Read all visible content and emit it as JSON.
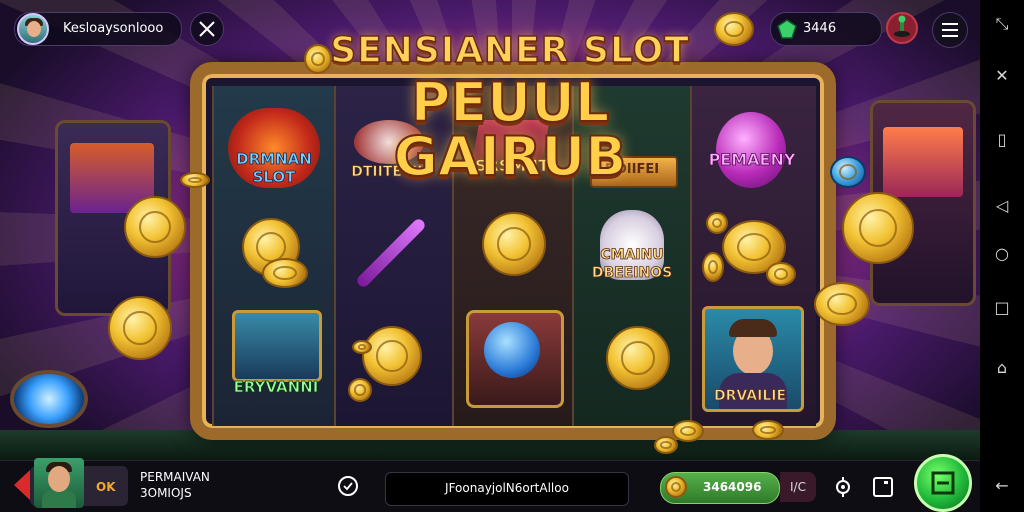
{
  "header": {
    "username": "Kesloaysonlooo",
    "balance": "3446"
  },
  "title": {
    "line1": "SENSIANER SLOT",
    "line2": "PEUUL GAIRUB"
  },
  "reels": {
    "r1_top": "DRMNAN SLOT",
    "r2_top": "DTIITE IIIC",
    "r3_top": "SRSMIIT",
    "r4_top": "DOIIFEI",
    "r5_top": "PEMAENY",
    "r4_mid": "CMAINU DBEEINOS",
    "r1_bottom": "ERYVANNI",
    "r5_bottom": "DRVAILIE"
  },
  "bottom": {
    "ok_tag": "OK",
    "player_line1": "PERMAIVAN",
    "player_line2": "3OMIOJS",
    "center_text": "JFoonayjolN6ortAlloo",
    "coins": "3464096",
    "vk_tag": "I/C"
  },
  "icons": {
    "tool": "crossed-swords-icon",
    "gem": "green-gem-icon",
    "joystick": "joystick-icon",
    "menu": "hamburger-menu-icon",
    "check": "check-circle-icon",
    "settings": "gear-icon",
    "square": "square-icon",
    "spin": "spin-icon"
  },
  "colors": {
    "title_gold": "#ffcf4a",
    "spin_green": "#1fb83a",
    "back_red": "#d92b2b"
  }
}
